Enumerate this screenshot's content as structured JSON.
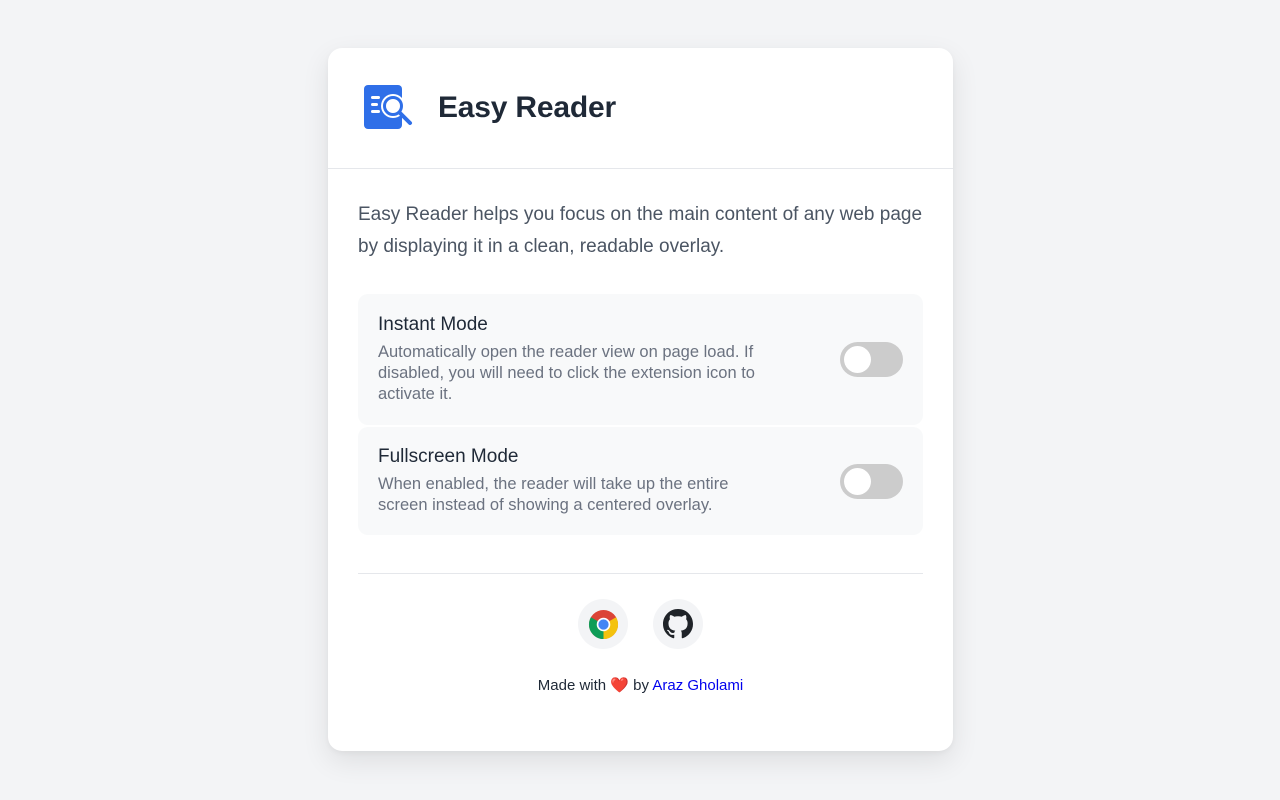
{
  "header": {
    "title": "Easy Reader",
    "logo_icon": "reader-search-icon",
    "logo_color": "#2f6fe8"
  },
  "description": "Easy Reader helps you focus on the main content of any web page by displaying it in a clean, readable overlay.",
  "settings": [
    {
      "title": "Instant Mode",
      "description": "Automatically open the reader view on page load. If disabled, you will need to click the extension icon to activate it.",
      "enabled": false
    },
    {
      "title": "Fullscreen Mode",
      "description": "When enabled, the reader will take up the entire screen instead of showing a centered overlay.",
      "enabled": false
    }
  ],
  "links": [
    {
      "icon": "chrome-icon"
    },
    {
      "icon": "github-icon"
    }
  ],
  "footer": {
    "made_with": "Made with",
    "heart": "❤️",
    "by": "by",
    "author": "Araz Gholami"
  },
  "colors": {
    "background": "#f3f4f6",
    "card": "#ffffff",
    "toggle_off": "#cccccc",
    "link": "#0000ee"
  }
}
